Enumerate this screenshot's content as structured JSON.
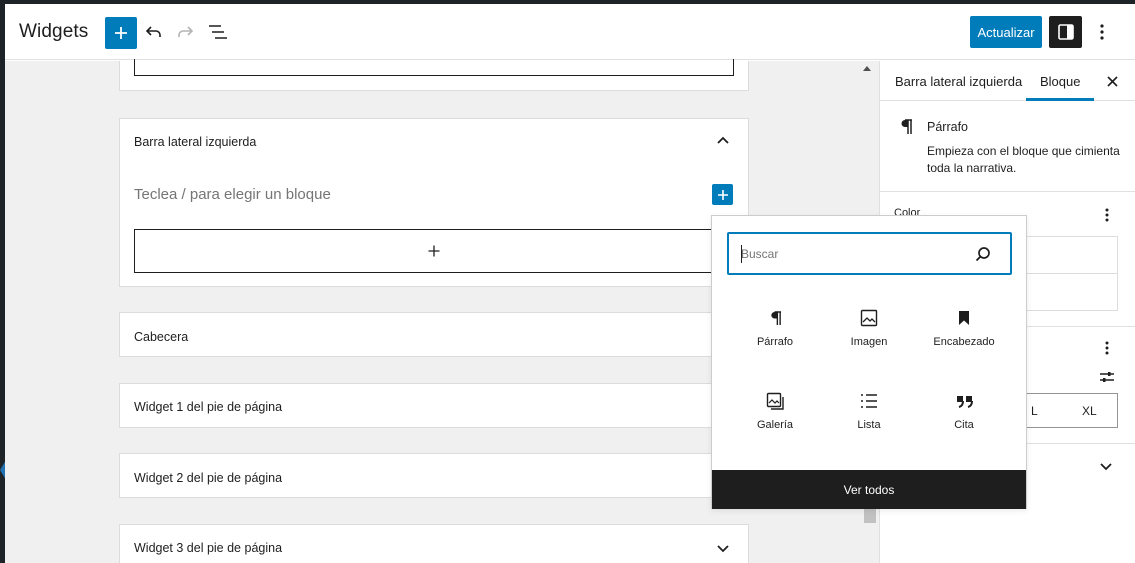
{
  "header": {
    "title": "Widgets",
    "update_label": "Actualizar"
  },
  "widgets": {
    "left_sidebar": {
      "title": "Barra lateral izquierda",
      "placeholder": "Teclea / para elegir un bloque"
    },
    "header_area": {
      "title": "Cabecera"
    },
    "footer1": {
      "title": "Widget 1 del pie de página"
    },
    "footer2": {
      "title": "Widget 2 del pie de página"
    },
    "footer3": {
      "title": "Widget 3 del pie de página"
    }
  },
  "sidebar": {
    "tabs": [
      {
        "label": "Barra lateral izquierda"
      },
      {
        "label": "Bloque"
      }
    ],
    "block": {
      "name": "Párrafo",
      "description": "Empieza con el bloque que cimienta toda la narrativa."
    },
    "color_panel_title": "Color",
    "size_options": {
      "l": "L",
      "xl": "XL"
    }
  },
  "inserter": {
    "search_placeholder": "Buscar",
    "items": [
      {
        "label": "Párrafo",
        "icon": "paragraph-icon"
      },
      {
        "label": "Imagen",
        "icon": "image-icon"
      },
      {
        "label": "Encabezado",
        "icon": "bookmark-icon"
      },
      {
        "label": "Galería",
        "icon": "gallery-icon"
      },
      {
        "label": "Lista",
        "icon": "list-icon"
      },
      {
        "label": "Cita",
        "icon": "quote-icon"
      }
    ],
    "view_all_label": "Ver todos"
  },
  "colors": {
    "accent": "#007cba",
    "dark": "#1e1e1e",
    "canvas_bg": "#f0f0f0"
  }
}
